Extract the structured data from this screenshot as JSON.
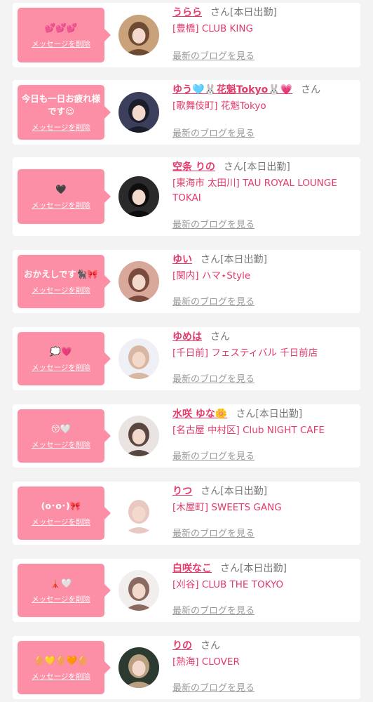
{
  "entries": [
    {
      "bubble_text": "💕💕💕",
      "delete_label": "メッセージを削除",
      "name": "うらら",
      "san": "さん",
      "status": "[本日出勤]",
      "shop": "[豊橋] CLUB KING",
      "blog_label": "最新のブログを見る",
      "avatar_colors": [
        "#c9a27c",
        "#6e4a32"
      ]
    },
    {
      "bubble_text": "今日も一日お疲れ様です😌",
      "delete_label": "メッセージを削除",
      "name": "ゆう🩵🐰花魁Tokyo🐰💗",
      "san": "さん",
      "status": "",
      "shop": "[歌舞伎町] 花魁Tokyo",
      "blog_label": "最新のブログを見る",
      "avatar_colors": [
        "#3b3f5c",
        "#1c1d2b"
      ]
    },
    {
      "bubble_text": "🖤",
      "delete_label": "メッセージを削除",
      "name": "空条 りの",
      "san": "さん",
      "status": "[本日出勤]",
      "shop": "[東海市 太田川] TAU ROYAL LOUNGE TOKAI",
      "blog_label": "最新のブログを見る",
      "avatar_colors": [
        "#2a2a2a",
        "#0e0e0e"
      ]
    },
    {
      "bubble_text": "おかえしです🐈‍⬛🎀",
      "delete_label": "メッセージを削除",
      "name": "ゆい",
      "san": "さん",
      "status": "[本日出勤]",
      "shop": "[関内] ハマ⋆Style",
      "blog_label": "最新のブログを見る",
      "avatar_colors": [
        "#d8a89a",
        "#7a4a3e"
      ]
    },
    {
      "bubble_text": "💭💗",
      "delete_label": "メッセージを削除",
      "name": "ゆめは",
      "san": "さん",
      "status": "",
      "shop": "[千日前] フェスティバル 千日前店",
      "blog_label": "最新のブログを見る",
      "avatar_colors": [
        "#eef0f6",
        "#d7b6a2"
      ]
    },
    {
      "bubble_text": "😚🤍",
      "delete_label": "メッセージを削除",
      "name": "水咲 ゆな🌼",
      "san": "さん",
      "status": "[本日出勤]",
      "shop": "[名古屋 中村区] Club NIGHT CAFE",
      "blog_label": "最新のブログを見る",
      "avatar_colors": [
        "#e9e4e2",
        "#5a4640"
      ]
    },
    {
      "bubble_text": "(o･o･)🎀",
      "delete_label": "メッセージを削除",
      "name": "りつ",
      "san": "さん",
      "status": "[本日出勤]",
      "shop": "[木屋町] SWEETS GANG",
      "blog_label": "最新のブログを見る",
      "avatar_colors": [
        "#ffffff",
        "#e8c8c0"
      ]
    },
    {
      "bubble_text": "🗼🤍",
      "delete_label": "メッセージを削除",
      "name": "白咲なこ",
      "san": "さん",
      "status": "[本日出勤]",
      "shop": "[刈谷] CLUB THE TOKYO",
      "blog_label": "最新のブログを見る",
      "avatar_colors": [
        "#f2eeee",
        "#8a6a60"
      ]
    },
    {
      "bubble_text": "🥚💛🥚🧡🥚",
      "delete_label": "メッセージを削除",
      "name": "りの",
      "san": "さん",
      "status": "",
      "shop": "[熱海] CLOVER",
      "blog_label": "最新のブログを見る",
      "avatar_colors": [
        "#2c3a30",
        "#b8a080"
      ]
    }
  ]
}
